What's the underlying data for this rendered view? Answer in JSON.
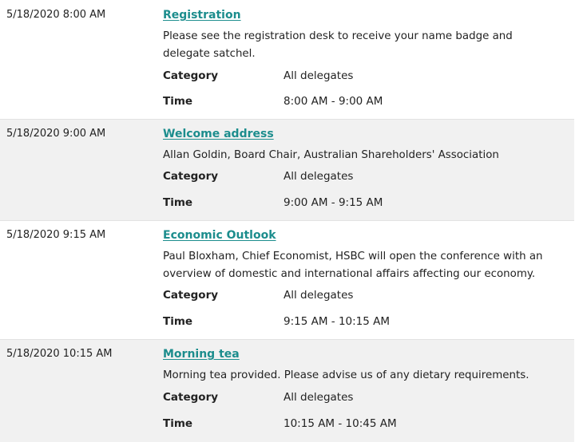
{
  "sessions": [
    {
      "datetime": "5/18/2020 8:00 AM",
      "title": "Registration",
      "description": "Please see the registration desk to receive your name badge and delegate satchel.",
      "category_label": "Category",
      "category_value": "All delegates",
      "time_label": "Time",
      "time_value": "8:00 AM - 9:00 AM"
    },
    {
      "datetime": "5/18/2020 9:00 AM",
      "title": "Welcome address",
      "description": "Allan Goldin, Board Chair, Australian Shareholders' Association",
      "category_label": "Category",
      "category_value": "All delegates",
      "time_label": "Time",
      "time_value": "9:00 AM - 9:15 AM"
    },
    {
      "datetime": "5/18/2020 9:15 AM",
      "title": "Economic Outlook",
      "description": "Paul Bloxham, Chief Economist, HSBC will open the conference with an overview of domestic and international affairs affecting our economy.",
      "category_label": "Category",
      "category_value": "All delegates",
      "time_label": "Time",
      "time_value": "9:15 AM - 10:15 AM"
    },
    {
      "datetime": "5/18/2020 10:15 AM",
      "title": "Morning tea",
      "description": "Morning tea provided. Please advise us of any dietary requirements.",
      "category_label": "Category",
      "category_value": "All delegates",
      "time_label": "Time",
      "time_value": "10:15 AM - 10:45 AM"
    }
  ]
}
